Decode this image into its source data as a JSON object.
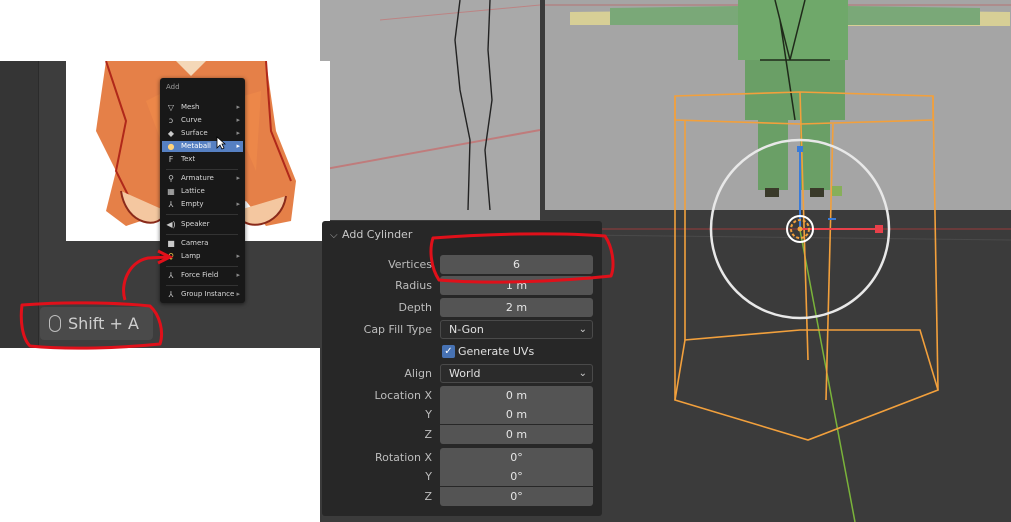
{
  "inset": {
    "menu_title": "Add",
    "menu_items": [
      {
        "icon": "mesh-icon",
        "glyph": "▽",
        "label": "Mesh",
        "submenu": true
      },
      {
        "icon": "curve-icon",
        "glyph": "ↄ",
        "label": "Curve",
        "submenu": true
      },
      {
        "icon": "surface-icon",
        "glyph": "◆",
        "label": "Surface",
        "submenu": true
      },
      {
        "icon": "metaball-icon",
        "glyph": "●",
        "label": "Metaball",
        "submenu": true,
        "highlighted": true
      },
      {
        "icon": "text-icon",
        "glyph": "F",
        "label": "Text",
        "submenu": false
      },
      {
        "icon": "armature-icon",
        "glyph": "⚲",
        "label": "Armature",
        "submenu": true
      },
      {
        "icon": "lattice-icon",
        "glyph": "▦",
        "label": "Lattice",
        "submenu": false
      },
      {
        "icon": "empty-icon",
        "glyph": "⅄",
        "label": "Empty",
        "submenu": true
      },
      {
        "icon": "speaker-icon",
        "glyph": "◀)",
        "label": "Speaker",
        "submenu": false
      },
      {
        "icon": "camera-icon",
        "glyph": "■",
        "label": "Camera",
        "submenu": false
      },
      {
        "icon": "lamp-icon",
        "glyph": "♀",
        "label": "Lamp",
        "submenu": true
      },
      {
        "icon": "force-field-icon",
        "glyph": "⅄",
        "label": "Force Field",
        "submenu": true
      },
      {
        "icon": "group-instance-icon",
        "glyph": "⅄",
        "label": "Group Instance",
        "submenu": true
      }
    ],
    "shortcut": "Shift + A"
  },
  "panel": {
    "title": "Add Cylinder",
    "vertices_label": "Vertices",
    "vertices_value": "6",
    "radius_label": "Radius",
    "radius_value": "1 m",
    "depth_label": "Depth",
    "depth_value": "2 m",
    "cap_fill_label": "Cap Fill Type",
    "cap_fill_value": "N-Gon",
    "generate_uvs_label": "Generate UVs",
    "generate_uvs_checked": true,
    "align_label": "Align",
    "align_value": "World",
    "location_x_label": "Location X",
    "location_x_value": "0 m",
    "location_y_label": "Y",
    "location_y_value": "0 m",
    "location_z_label": "Z",
    "location_z_value": "0 m",
    "rotation_x_label": "Rotation X",
    "rotation_x_value": "0°",
    "rotation_y_label": "Y",
    "rotation_y_value": "0°",
    "rotation_z_label": "Z",
    "rotation_z_value": "0°"
  },
  "colors": {
    "selection_orange": "#f2a03c",
    "annotation_red": "#e0101a",
    "menu_highlight": "#5680c2",
    "x_axis_red": "#e8404a",
    "y_axis_green": "#7ab33a",
    "z_gizmo_blue": "#3a7bd8"
  }
}
